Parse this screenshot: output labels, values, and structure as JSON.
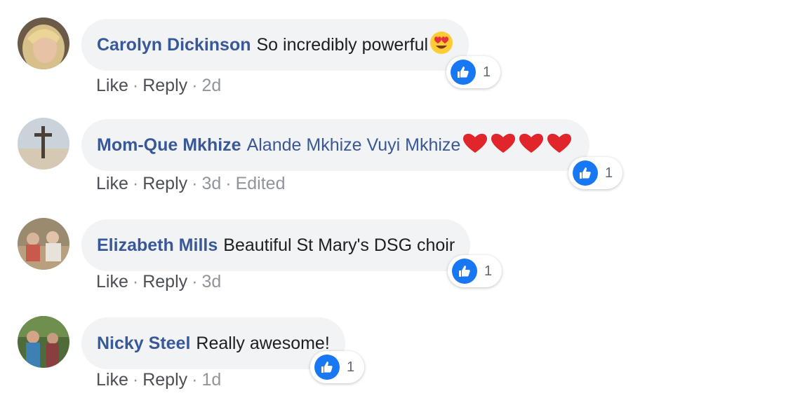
{
  "comments": [
    {
      "author": "Carolyn Dickinson",
      "text": "So incredibly powerful",
      "emoji": "heart-eyes-emoji",
      "actions": {
        "like": "Like",
        "reply": "Reply",
        "time": "2d"
      },
      "reaction_count": "1"
    },
    {
      "author": "Mom-Que Mkhize",
      "text": "Alande Mkhize Vuyi Mkhize",
      "emoji": "red-heart-emoji x4",
      "actions": {
        "like": "Like",
        "reply": "Reply",
        "time": "3d",
        "edited": "Edited"
      },
      "reaction_count": "1"
    },
    {
      "author": "Elizabeth Mills",
      "text": "Beautiful St Mary's DSG choir",
      "actions": {
        "like": "Like",
        "reply": "Reply",
        "time": "3d"
      },
      "reaction_count": "1"
    },
    {
      "author": "Nicky Steel",
      "text": "Really awesome!",
      "actions": {
        "like": "Like",
        "reply": "Reply",
        "time": "1d"
      },
      "reaction_count": "1"
    }
  ],
  "separator": "·",
  "colors": {
    "author": "#385898",
    "bubble": "#f2f3f5",
    "like": "#1877f2",
    "meta": "#90949c"
  }
}
